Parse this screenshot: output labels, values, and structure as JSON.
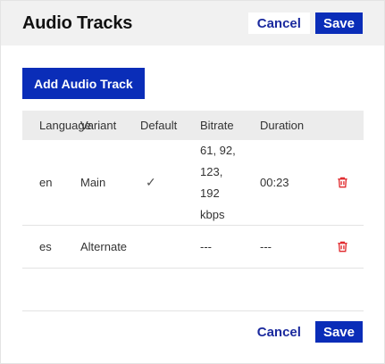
{
  "dialog": {
    "title": "Audio Tracks",
    "cancel_label": "Cancel",
    "save_label": "Save",
    "add_label": "Add Audio Track"
  },
  "table": {
    "headers": [
      "Language",
      "Variant",
      "Default",
      "Bitrate",
      "Duration"
    ],
    "rows": [
      {
        "language": "en",
        "variant": "Main",
        "default": "✓",
        "bitrate": "61, 92, 123, 192 kbps",
        "bitrate_lines": [
          "61, 92,",
          "123,",
          "192",
          "kbps"
        ],
        "duration": "00:23"
      },
      {
        "language": "es",
        "variant": "Alternate",
        "default": "",
        "bitrate": "---",
        "duration": "---"
      }
    ]
  },
  "footer": {
    "cancel_label": "Cancel",
    "save_label": "Save"
  },
  "colors": {
    "primary": "#0a2db8",
    "link": "#1b2a9e",
    "danger": "#e0262a",
    "header_bg": "#f1f1f1"
  },
  "icons": {
    "delete": "trash-icon",
    "default_check": "check-icon"
  }
}
